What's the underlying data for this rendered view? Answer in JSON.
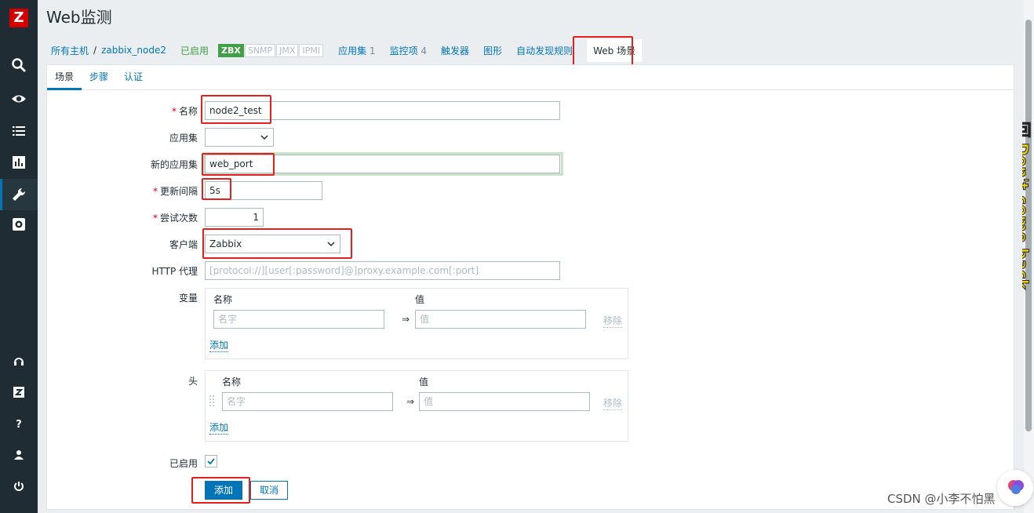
{
  "app": {
    "logo_letter": "Z",
    "page_title": "Web监测"
  },
  "colors": {
    "sidebar": "#1f2c33",
    "accent": "#0275b8",
    "enabled_green": "#429e47",
    "highlight_red": "#e3201c"
  },
  "sidebar": {
    "icons": [
      "search-icon",
      "eye-icon",
      "list-icon",
      "chart-icon",
      "wrench-icon",
      "gear-icon",
      "support-icon",
      "zabbix-share-icon",
      "help-icon",
      "user-icon",
      "power-icon"
    ],
    "active": "wrench-icon"
  },
  "breadcrumb": {
    "all_hosts": "所有主机",
    "separator": "/",
    "host": "zabbix_node2",
    "status": "已启用",
    "badges": [
      "ZBX",
      "SNMP",
      "JMX",
      "IPMI"
    ],
    "links": [
      {
        "label": "应用集",
        "count": "1"
      },
      {
        "label": "监控项",
        "count": "4"
      },
      {
        "label": "触发器",
        "count": ""
      },
      {
        "label": "图形",
        "count": ""
      },
      {
        "label": "自动发现规则",
        "count": ""
      },
      {
        "label": "Web 场景",
        "count": ""
      }
    ]
  },
  "tabs": [
    "场景",
    "步骤",
    "认证"
  ],
  "form": {
    "name_label": "名称",
    "name_value": "node2_test",
    "app_label": "应用集",
    "app_value": "",
    "new_app_label": "新的应用集",
    "new_app_value": "web_port",
    "interval_label": "更新间隔",
    "interval_value": "5s",
    "attempts_label": "尝试次数",
    "attempts_value": "1",
    "agent_label": "客户端",
    "agent_value": "Zabbix",
    "proxy_label": "HTTP 代理",
    "proxy_placeholder": "[protocol://][user[:password]@]proxy.example.com[:port]",
    "variables_label": "变量",
    "headers_label": "头",
    "col_name": "名称",
    "col_value": "值",
    "name_placeholder": "名字",
    "value_placeholder": "值",
    "arrow": "⇒",
    "remove": "移除",
    "add": "添加",
    "enabled_label": "已启用",
    "enabled_checked": true,
    "submit_label": "添加",
    "cancel_label": "取消"
  },
  "watermark": "CSDN @小李不怕黑",
  "side_deco_text": "回 Don't come back"
}
